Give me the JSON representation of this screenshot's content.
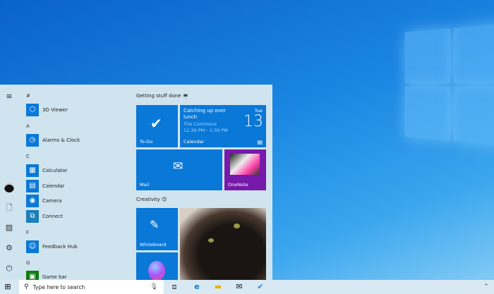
{
  "start_menu": {
    "rail": [
      "menu-icon",
      "avatar",
      "documents-icon",
      "pictures-icon",
      "settings-icon",
      "power-icon"
    ],
    "letters": [
      "#",
      "A",
      "C",
      "F",
      "G"
    ],
    "apps": [
      {
        "label": "3D Viewer"
      },
      {
        "label": "Alarms & Clock"
      },
      {
        "label": "Calculator"
      },
      {
        "label": "Calendar"
      },
      {
        "label": "Camera"
      },
      {
        "label": "Connect"
      },
      {
        "label": "Feedback Hub"
      },
      {
        "label": "Game bar"
      }
    ],
    "groups": [
      "Getting stuff done 💻",
      "Creativity 😊"
    ],
    "tiles": {
      "todo": "To-Do",
      "calendar": "Calendar",
      "mail": "Mail",
      "onenote": "OneNote",
      "whiteboard": "Whiteboard"
    },
    "event": {
      "title": "Catching up over lunch",
      "location": "The Commons",
      "time": "12:30 PM - 1:30 PM",
      "day": "Tue",
      "date": "13"
    }
  },
  "taskbar": {
    "search_placeholder": "Type here to search"
  }
}
